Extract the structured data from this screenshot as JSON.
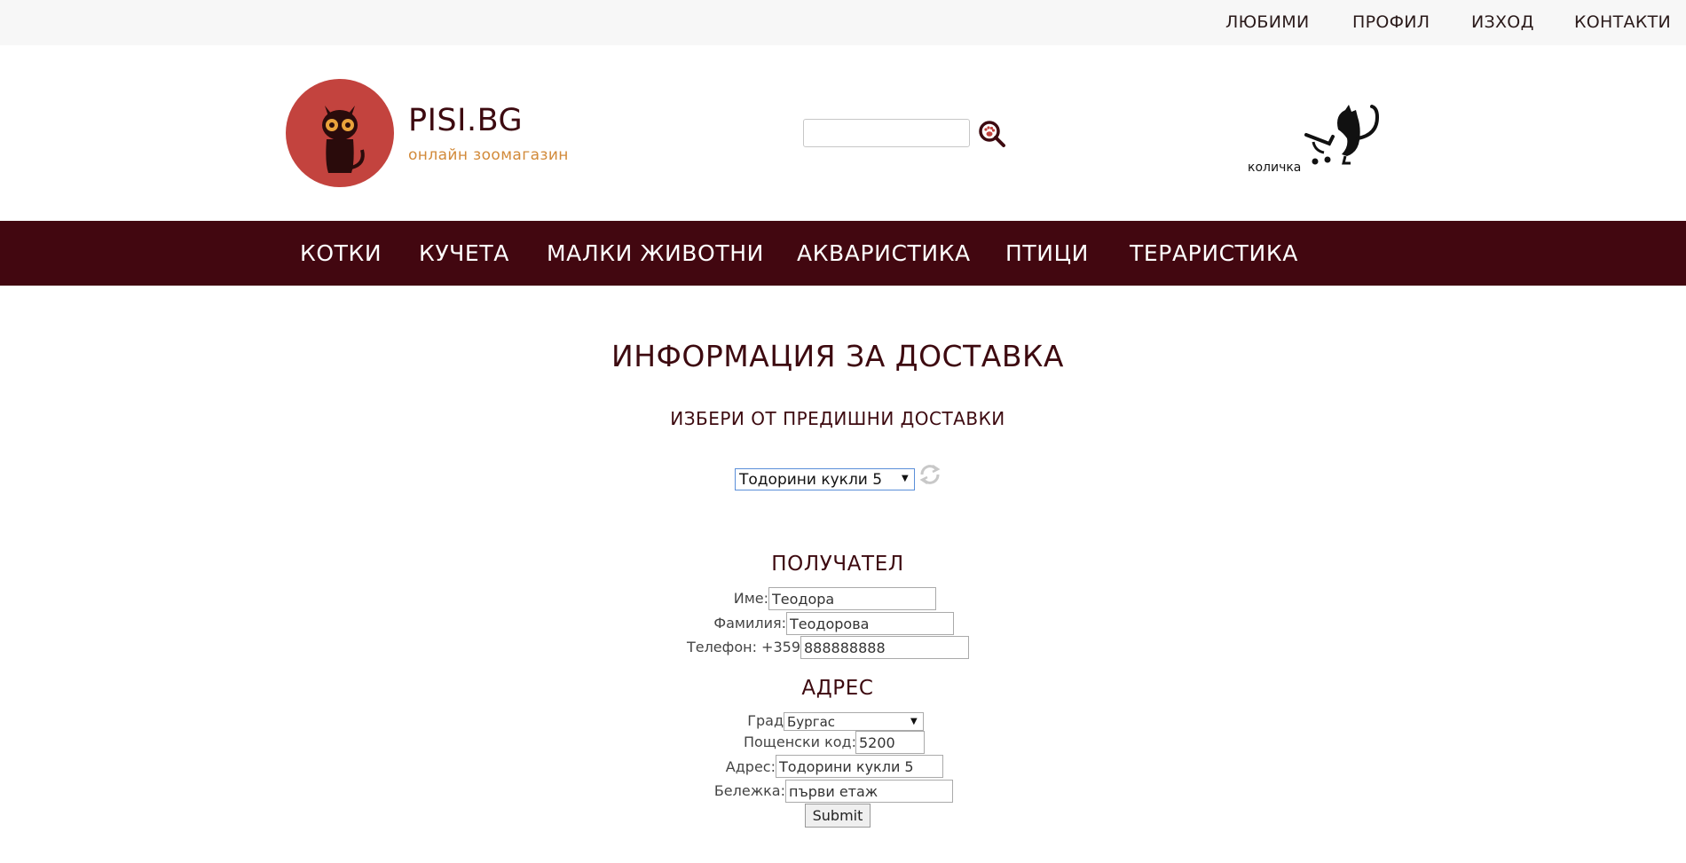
{
  "topnav": {
    "favorites": "ЛЮБИМИ",
    "profile": "ПРОФИЛ",
    "logout": "ИЗХОД",
    "contacts": "КОНТАКТИ"
  },
  "brand": {
    "title": "PISI.BG",
    "subtitle": "онлайн зоомагазин"
  },
  "search": {
    "value": "",
    "placeholder": ""
  },
  "cart": {
    "label": "количка"
  },
  "categories": [
    "КОТКИ",
    "КУЧЕТА",
    "МАЛКИ ЖИВОТНИ",
    "АКВАРИСТИКА",
    "ПТИЦИ",
    "ТЕРАРИСТИКА"
  ],
  "page": {
    "title": "ИНФОРМАЦИЯ ЗА ДОСТАВКА",
    "previous_label": "ИЗБЕРИ ОТ ПРЕДИШНИ ДОСТАВКИ",
    "previous_selected": "Тодорини кукли 5"
  },
  "recipient": {
    "title": "ПОЛУЧАТЕЛ",
    "first_name_label": "Име:",
    "first_name_value": "Теодора",
    "last_name_label": "Фамилия:",
    "last_name_value": "Теодорова",
    "phone_label": "Телефон: +359",
    "phone_value": "888888888"
  },
  "address": {
    "title": "АДРЕС",
    "city_label": "Град",
    "city_value": "Бургас",
    "postcode_label": "Пощенски код:",
    "postcode_value": "5200",
    "address_label": "Адрес:",
    "address_value": "Тодорини кукли 5",
    "note_label": "Бележка:",
    "note_value": "първи етаж"
  },
  "form": {
    "submit": "Submit"
  },
  "colors": {
    "brand_dark": "#420710",
    "logo_red": "#c3433e",
    "accent_orange": "#d28a3a",
    "topbar_bg": "#f7f7f7"
  }
}
